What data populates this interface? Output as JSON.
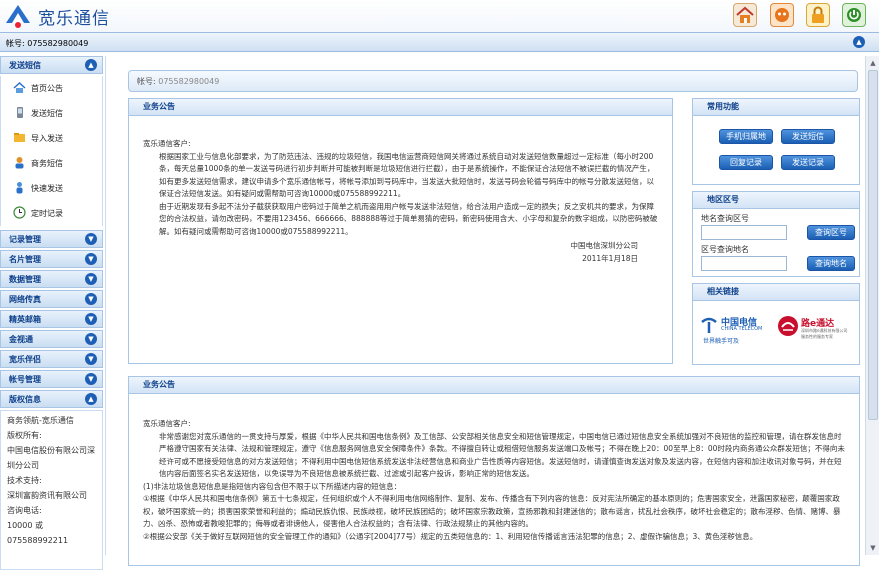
{
  "app": {
    "brand": "宽乐通信"
  },
  "account_bar": {
    "label": "帐号: 075582980049"
  },
  "sidebar": {
    "first_section": {
      "title": "发送短信",
      "items": [
        "首页公告",
        "发送短信",
        "导入发送",
        "商务短信",
        "快速发送",
        "定时记录"
      ]
    },
    "sections": [
      "记录管理",
      "名片管理",
      "数据管理",
      "网络传真",
      "精英邮箱",
      "金视通",
      "宽乐伴侣",
      "帐号管理",
      "版权信息"
    ],
    "info": [
      "商务领航-宽乐通信",
      "版权所有:",
      "中国电信股份有限公司深圳分公司",
      "技术支持:",
      "深圳富韵资讯有限公司",
      "咨询电话:",
      "10000 或075588992211"
    ]
  },
  "main": {
    "account": {
      "label": "帐号: ",
      "value": "075582980049"
    },
    "notice1": {
      "title": "业务公告",
      "greeting": "宽乐通信客户:",
      "para1": "根据国家工业与信息化部要求，为了防范违法、违规的垃圾短信，我国电信运营商短信网关将通过系统自动对发送短信数量超过一定标准（每小时200条，每天总量1000条的单一发送号码进行初步判断并可能被判断是垃圾短信进行拦截），由于是系统操作，不能保证合法短信不被误拦截的情况产生，如有更多发送短信需求，建议申请多个宽乐通信帐号，将帐号添加到号码库中，当发送大批短信时，发送号码会轮循号码库中的帐号分散发送短信，以保证合法短信发送。如有疑问或需帮助可咨询10000或075588992211。",
      "para2": "由于近期发现有多起不法分子截获获取用户密码过于简单之机而盗用用户帐号发送非法短信，给合法用户造成一定的损失；反之安机共的要求，为保障您的合法权益，请勿改密码，不要用123456、666666、888888等过于简单易猜的密码，新密码使用含大、小字母和复杂的数字组成，以防密码被破解。如有疑问或需帮助可咨询10000或075588992211。",
      "sign_company": "中国电信深圳分公司",
      "sign_date": "2011年1月18日"
    },
    "notice2": {
      "title": "业务公告",
      "greeting": "宽乐通信客户:",
      "para1": "非常感谢您对宽乐通信的一贯支持与厚爱，根据《中华人民共和国电信条例》及工信部、公安部相关信息安全和短信管理规定，中国电信已通过短信息安全系统加强对不良短信的监控和管理，请在群发信息时严格遵守国家有关法律、法规和管理规定，遵守《信息服务网信息安全保障条件》条款。不得擅自转让或租借短信服务发送端口及帐号；不得在晚上20：00至早上8：00时段内商务通公众群发短信；不得向未经许可或不愿接受短信息的对方发送短信；不得利用中国电信短信系统发送非法经营信息和商业广告性质等内容短信。发送短信时，请谨慎查询发送对象及发送内容，在短信内容和加注收讯对象号码，并在短信内容后面签名实名发送短信，以免误导为不良短信息被系统拦截、过滤或引起客户投诉，影响正常的短信发送。",
      "para2": "(1)非法垃圾信息短信息是指短信内容包含但不限于以下所描述内容的短信息：",
      "para3": "①根据《中华人民共和国电信条例》第五十七条规定，任何组织或个人不得利用电信网络制作、复制、发布、传播含有下列内容的信息：反对宪法所确定的基本原则的；危害国家安全，泄露国家秘密，颠覆国家政权，破坏国家统一的；损害国家荣誉和利益的；煽动民族仇恨、民族歧视，破坏民族团结的；破坏国家宗教政策，宣扬邪教和封建迷信的；散布谣言，扰乱社会秩序，破坏社会稳定的；散布淫秽、色情、赌博、暴力、凶杀、恐怖或者教唆犯罪的；侮辱或者诽谤他人，侵害他人合法权益的；含有法律、行政法规禁止的其他内容的。",
      "para4": "②根据公安部《关于做好互联网短信的安全管理工作的通知》（公通字[2004]77号）规定的五类短信息的：1、利用短信传播谣言违法犯罪的信息；2、虚假诈骗信息；3、黄色淫秽信息。"
    },
    "functions": {
      "title": "常用功能",
      "buttons": [
        "手机归属地",
        "发送短信",
        "回复记录",
        "发送记录"
      ]
    },
    "areacode": {
      "title": "地区区号",
      "city_label": "地名查询区号",
      "code_label": "区号查询地名",
      "btn_code": "查询区号",
      "btn_city": "查询地名"
    },
    "links": {
      "title": "相关链接",
      "ct_name": "中国电信",
      "ct_en": "CHINA TELECOM",
      "ct_slogan": "世界触手可及",
      "lu_name": "路e通达",
      "lu_sub": "深圳市路e通科技有限公司",
      "lu_sub2": "服务性的服务专家"
    }
  },
  "colors": {
    "accent": "#1d5fb5",
    "header_text": "#0d3f8a",
    "link_red": "#c8102e"
  }
}
